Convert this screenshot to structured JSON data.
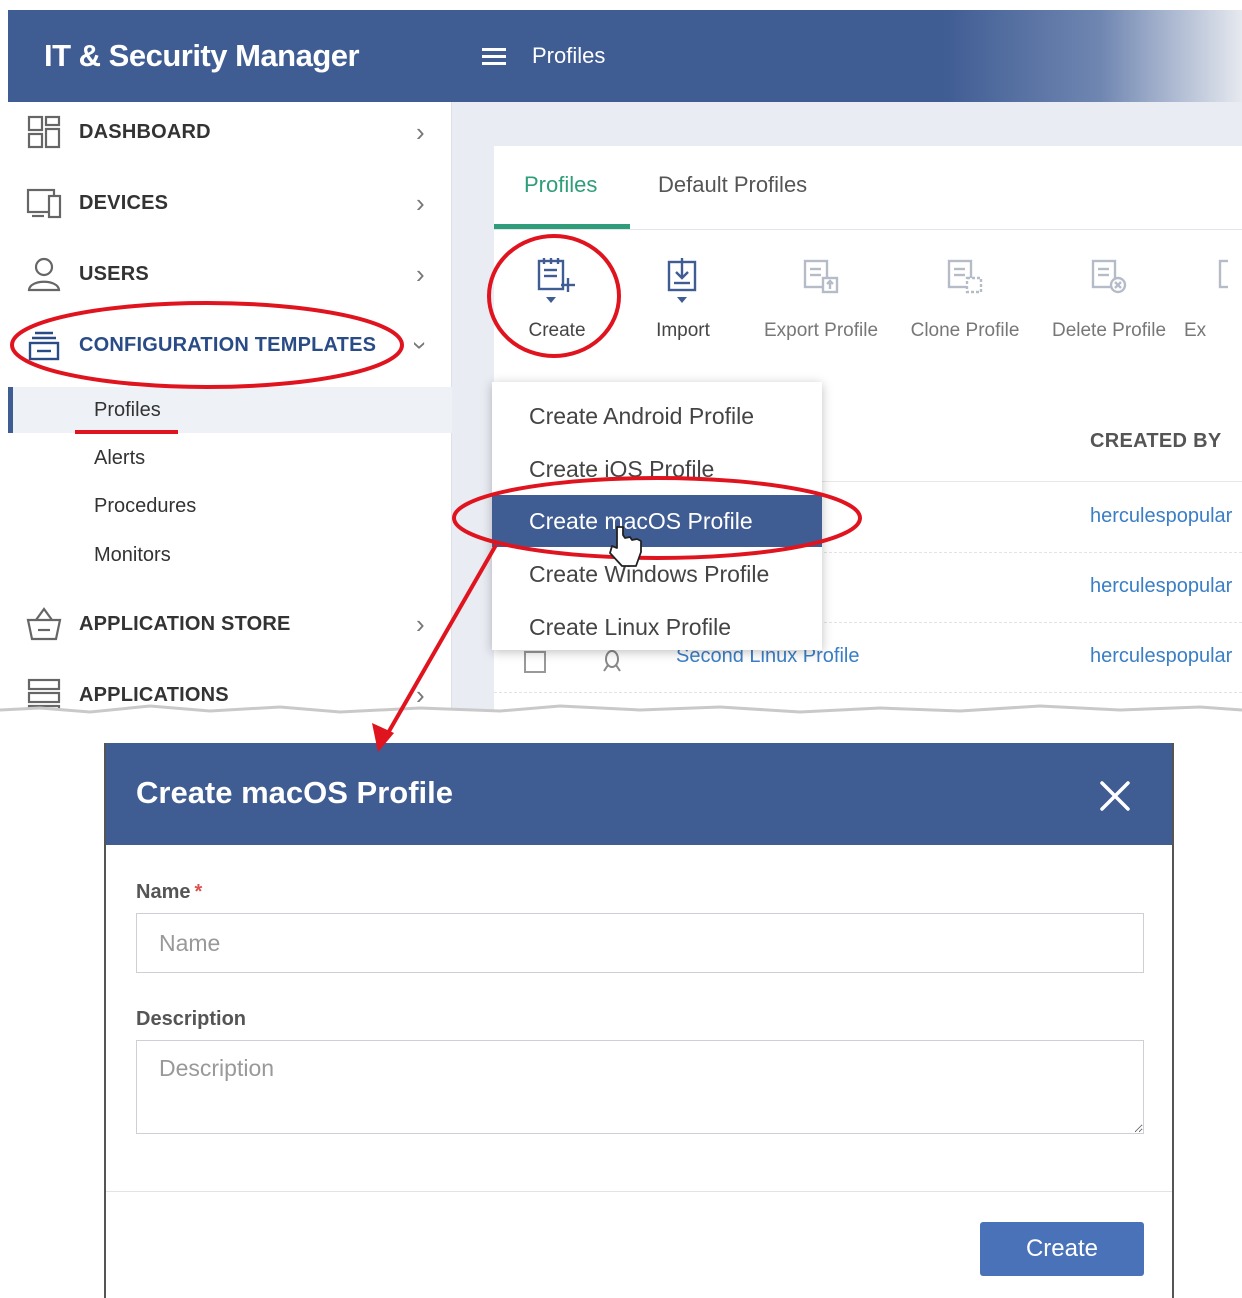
{
  "app": {
    "title": "IT & Security Manager"
  },
  "header": {
    "breadcrumb": "Profiles"
  },
  "sidebar": {
    "items": [
      {
        "label": "DASHBOARD",
        "icon": "dashboard-icon"
      },
      {
        "label": "DEVICES",
        "icon": "devices-icon"
      },
      {
        "label": "USERS",
        "icon": "user-icon"
      },
      {
        "label": "CONFIGURATION TEMPLATES",
        "icon": "configuration-icon",
        "expanded": true
      },
      {
        "label": "APPLICATION STORE",
        "icon": "store-icon"
      },
      {
        "label": "APPLICATIONS",
        "icon": "applications-icon"
      }
    ],
    "subitems": [
      {
        "label": "Profiles",
        "selected": true
      },
      {
        "label": "Alerts"
      },
      {
        "label": "Procedures"
      },
      {
        "label": "Monitors"
      }
    ]
  },
  "tabs": [
    {
      "label": "Profiles",
      "active": true
    },
    {
      "label": "Default Profiles"
    }
  ],
  "toolbar": {
    "buttons": [
      {
        "label": "Create",
        "icon": "create-profile-icon",
        "enabled": true
      },
      {
        "label": "Import",
        "icon": "import-icon",
        "enabled": true
      },
      {
        "label": "Export Profile",
        "icon": "export-profile-icon",
        "enabled": false
      },
      {
        "label": "Clone Profile",
        "icon": "clone-profile-icon",
        "enabled": false
      },
      {
        "label": "Delete Profile",
        "icon": "delete-profile-icon",
        "enabled": false
      },
      {
        "label": "Ex",
        "icon": "export-icon",
        "enabled": false
      }
    ]
  },
  "table": {
    "headers": {
      "created_by": "CREATED BY"
    },
    "rows": [
      {
        "created_by": "herculespopular"
      },
      {
        "created_by": "herculespopular"
      },
      {
        "name": "Second Linux Profile",
        "created_by": "herculespopular"
      }
    ]
  },
  "dropdown": {
    "items": [
      {
        "label": "Create Android Profile"
      },
      {
        "label": "Create iOS Profile"
      },
      {
        "label": "Create macOS Profile",
        "highlighted": true
      },
      {
        "label": "Create Windows Profile"
      },
      {
        "label": "Create Linux Profile"
      }
    ]
  },
  "modal": {
    "title": "Create macOS Profile",
    "name_label": "Name",
    "required_mark": "*",
    "name_placeholder": "Name",
    "name_value": "",
    "description_label": "Description",
    "description_placeholder": "Description",
    "description_value": "",
    "create_label": "Create"
  },
  "colors": {
    "brand": "#3f5c93",
    "tab_active": "#2f9d7a",
    "link": "#3a7ec6",
    "button": "#4a72b8",
    "annotation": "#e0141e"
  }
}
